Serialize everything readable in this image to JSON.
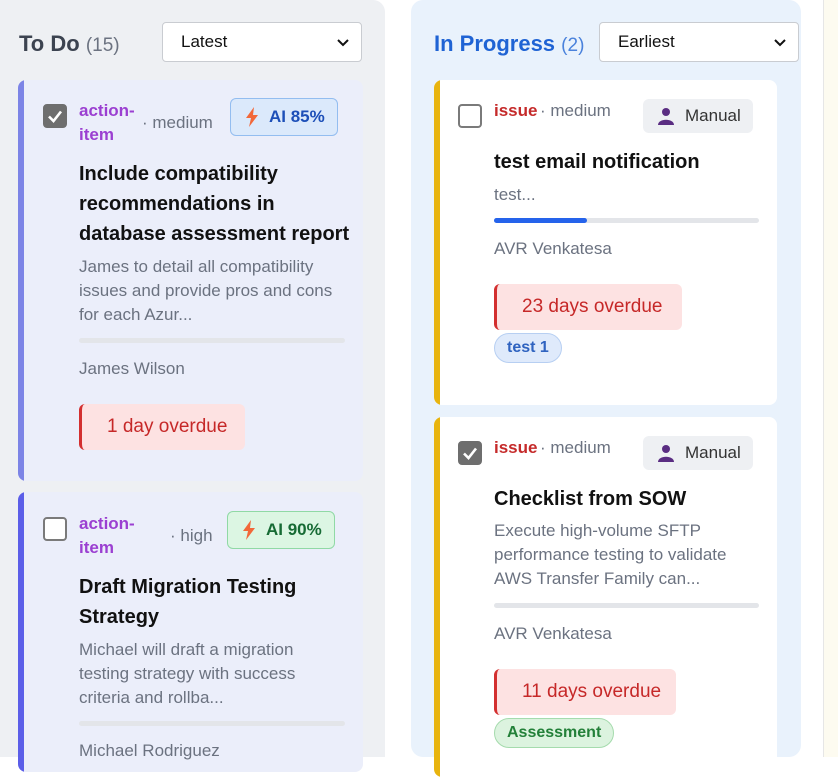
{
  "columns": {
    "todo": {
      "title": "To Do",
      "count": "(15)",
      "sort": "Latest"
    },
    "in_progress": {
      "title": "In Progress",
      "count": "(2)",
      "sort": "Earliest"
    }
  },
  "todo_cards": [
    {
      "checked": true,
      "type_line1": "action-",
      "type_line2": "item",
      "priority": "· medium",
      "badge": "AI 85%",
      "title_lines": [
        "Include compatibility",
        "recommendations in",
        "database assessment report"
      ],
      "desc_lines": [
        "James to detail all compatibility",
        "issues and provide pros and cons",
        "for each Azur..."
      ],
      "progress": 0,
      "owner": "James Wilson",
      "overdue": "1 day overdue",
      "accent": "#7c84e6"
    },
    {
      "checked": false,
      "type_line1": "action-",
      "type_line2": "item",
      "priority": "· high",
      "badge": "AI 90%",
      "title_lines": [
        "Draft Migration Testing",
        "Strategy"
      ],
      "desc_lines": [
        "Michael will draft a migration",
        "testing strategy with success",
        "criteria and rollba..."
      ],
      "progress": 0,
      "owner": "Michael Rodriguez",
      "accent": "#5b5ee8"
    }
  ],
  "progress_cards": [
    {
      "checked": false,
      "type": "issue",
      "priority": "· medium",
      "badge": "Manual",
      "title": "test email notification",
      "desc_lines": [
        "test..."
      ],
      "progress": 0.35,
      "owner": "AVR Venkatesa",
      "overdue": "23 days overdue",
      "tag": "test 1",
      "accent": "#e8b40f"
    },
    {
      "checked": true,
      "type": "issue",
      "priority": "· medium",
      "badge": "Manual",
      "title": "Checklist from SOW",
      "desc_lines": [
        "Execute high-volume SFTP",
        "performance testing to validate",
        "AWS Transfer Family can..."
      ],
      "progress": 0,
      "owner": "AVR Venkatesa",
      "overdue": "11 days overdue",
      "tag": "Assessment",
      "accent": "#e8b40f"
    }
  ],
  "icons": {
    "ai": "lightning-bolt-icon",
    "manual": "person-icon",
    "checkbox": "checkmark-icon",
    "dropdown": "chevron-down-icon"
  }
}
